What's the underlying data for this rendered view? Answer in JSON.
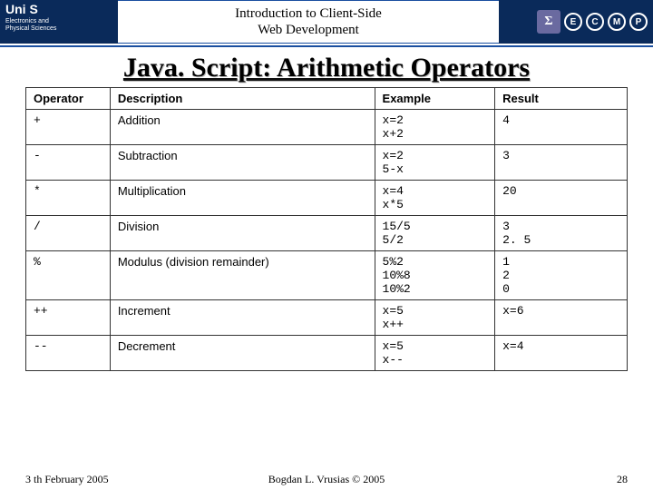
{
  "header": {
    "logo": "Uni S",
    "dept_line1": "Electronics and",
    "dept_line2": "Physical Sciences",
    "course_line1": "Introduction to Client-Side",
    "course_line2": "Web Development",
    "sigma": "Σ",
    "badges": [
      "E",
      "C",
      "M",
      "P"
    ]
  },
  "title": "Java. Script: Arithmetic Operators",
  "table": {
    "headers": [
      "Operator",
      "Description",
      "Example",
      "Result"
    ],
    "rows": [
      {
        "op": "+",
        "desc": "Addition",
        "ex": "x=2\nx+2",
        "res": "4"
      },
      {
        "op": "-",
        "desc": "Subtraction",
        "ex": "x=2\n5-x",
        "res": "3"
      },
      {
        "op": "*",
        "desc": "Multiplication",
        "ex": "x=4\nx*5",
        "res": "20"
      },
      {
        "op": "/",
        "desc": "Division",
        "ex": "15/5\n5/2",
        "res": "3\n2. 5"
      },
      {
        "op": "%",
        "desc": "Modulus (division remainder)",
        "ex": "5%2\n10%8\n10%2",
        "res": "1\n2\n0"
      },
      {
        "op": "++",
        "desc": "Increment",
        "ex": "x=5\nx++",
        "res": "x=6"
      },
      {
        "op": "--",
        "desc": "Decrement",
        "ex": "x=5\nx--",
        "res": "x=4"
      }
    ]
  },
  "footer": {
    "date": "3 th February 2005",
    "copyright": "Bogdan L. Vrusias © 2005",
    "page": "28"
  }
}
